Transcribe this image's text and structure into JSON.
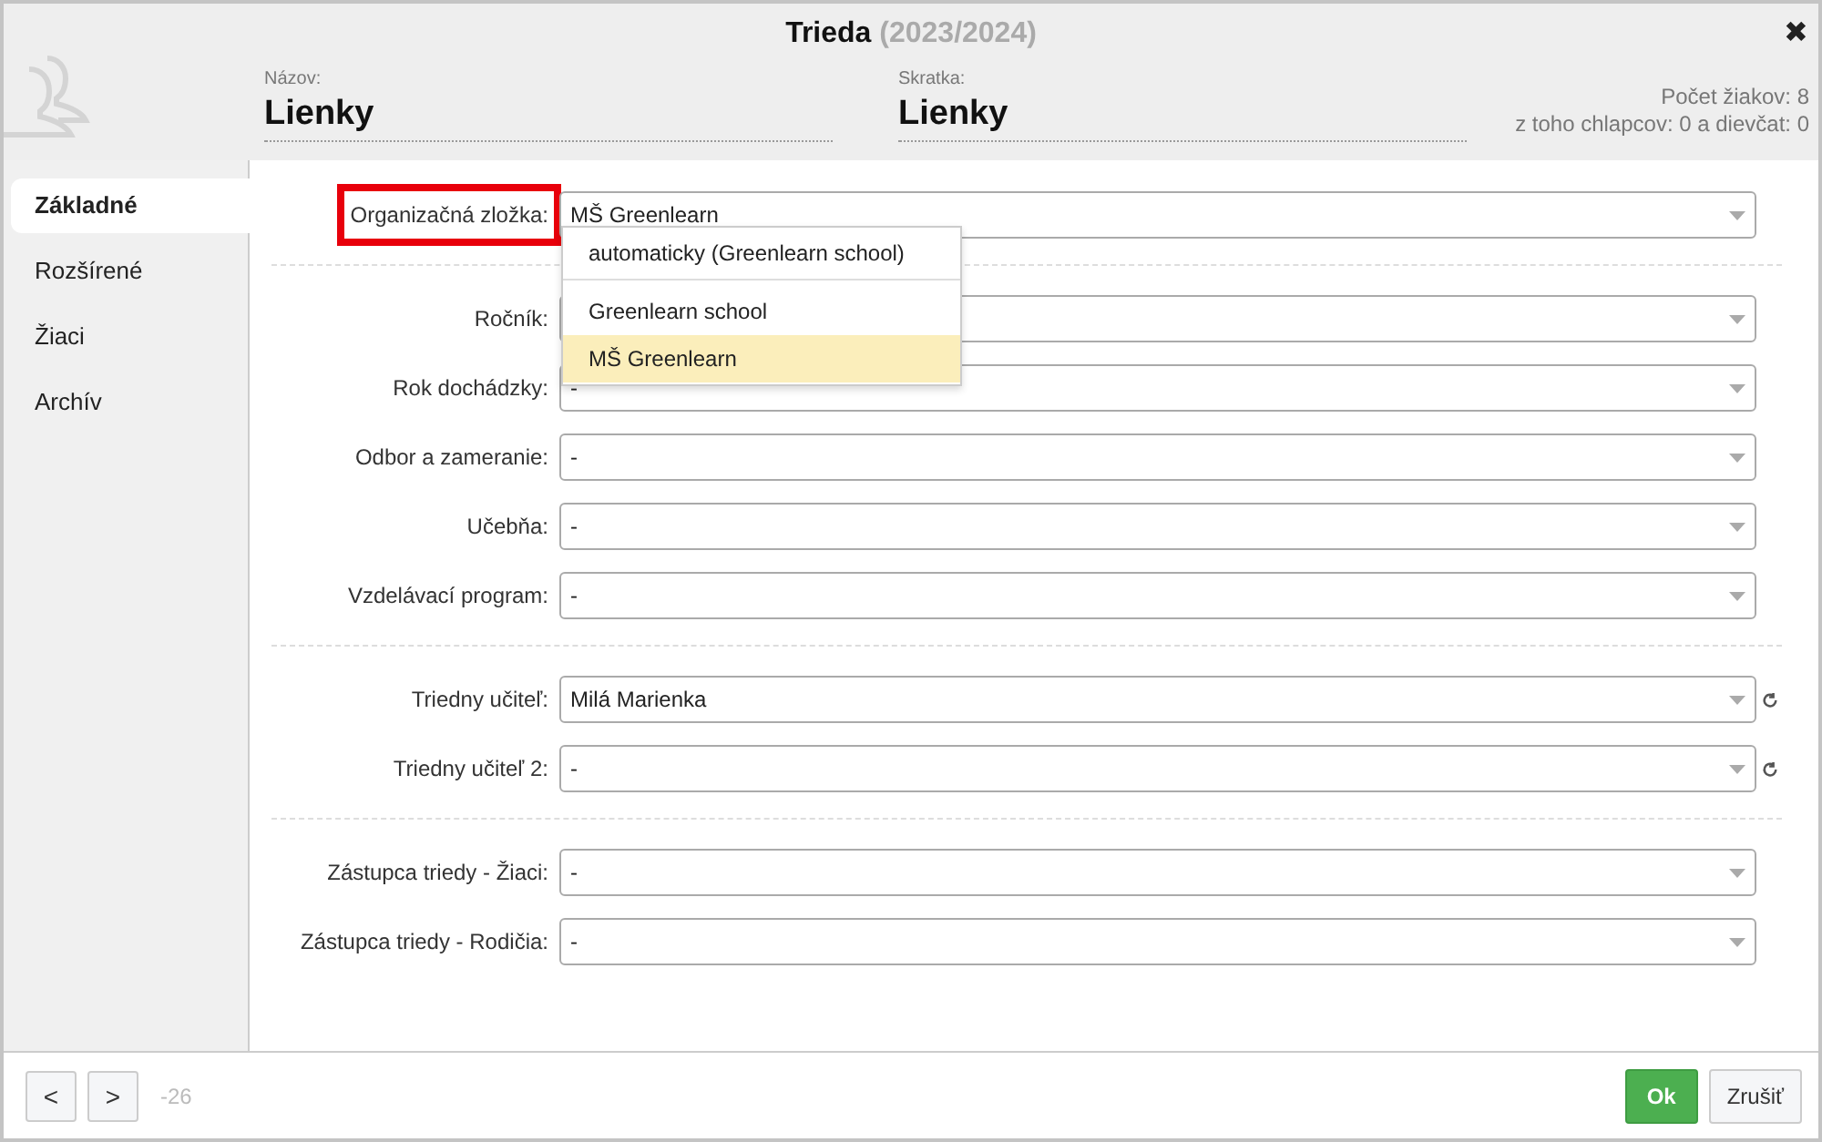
{
  "window": {
    "title": "Trieda",
    "subtitle": "(2023/2024)",
    "close": "✖"
  },
  "header": {
    "fields": [
      {
        "label": "Názov:",
        "value": "Lienky"
      },
      {
        "label": "Skratka:",
        "value": "Lienky"
      }
    ],
    "stats": [
      "Počet žiakov: 8",
      "z toho chlapcov: 0 a dievčat: 0"
    ]
  },
  "sidebar": {
    "items": [
      {
        "label": "Základné",
        "selected": true
      },
      {
        "label": "Rozšírené",
        "selected": false
      },
      {
        "label": "Žiaci",
        "selected": false
      },
      {
        "label": "Archív",
        "selected": false
      }
    ]
  },
  "form": {
    "groups": [
      [
        {
          "label": "Organizačná zložka:",
          "value": "MŠ Greenlearn",
          "highlighted": true
        }
      ],
      [
        {
          "label": "Ročník:"
        },
        {
          "label": "Rok dochádzky:",
          "value": "-"
        },
        {
          "label": "Odbor a zameranie:",
          "value": "-"
        },
        {
          "label": "Učebňa:",
          "value": "-"
        },
        {
          "label": "Vzdelávací program:",
          "value": "-"
        }
      ],
      [
        {
          "label": "Triedny učiteľ:",
          "value": "Milá Marienka",
          "refresh": true
        },
        {
          "label": "Triedny učiteľ 2:",
          "value": "-",
          "refresh": true
        }
      ],
      [
        {
          "label": "Zástupca triedy - Žiaci:",
          "value": "-"
        },
        {
          "label": "Zástupca triedy - Rodičia:",
          "value": "-"
        }
      ]
    ]
  },
  "dropdown": {
    "options": [
      {
        "label": "automaticky (Greenlearn school)",
        "kind": "auto",
        "selected": false
      },
      {
        "label": "Greenlearn school",
        "kind": "item",
        "selected": false
      },
      {
        "label": "MŠ Greenlearn",
        "kind": "item",
        "selected": true
      }
    ]
  },
  "footer": {
    "prev": "<",
    "next": ">",
    "counter": "-26",
    "ok": "Ok",
    "cancel": "Zrušiť"
  }
}
